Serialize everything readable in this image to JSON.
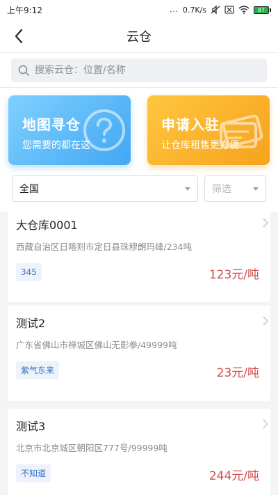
{
  "status": {
    "time": "上午9:12",
    "dots": "...",
    "speed": "0.7K/s",
    "battery": "87"
  },
  "nav": {
    "title": "云仓"
  },
  "search": {
    "placeholder": "搜索云仓：位置/名称"
  },
  "banners": [
    {
      "title": "地图寻仓",
      "subtitle": "您需要的都在这",
      "color": "#42a7f2",
      "icon": "question-bubble-icon"
    },
    {
      "title": "申请入驻",
      "subtitle": "让仓库租售更方便",
      "color": "#f7a21c",
      "icon": "card-stack-icon"
    }
  ],
  "filters": {
    "region": "全国",
    "filter_placeholder": "筛选"
  },
  "warehouses": [
    {
      "name": "大仓库0001",
      "address": "西藏自治区日喀则市定日县珠穆朗玛峰/234吨",
      "tag": "345",
      "price": "123元/吨"
    },
    {
      "name": "测试2",
      "address": "广东省佛山市禅城区佛山无影拳/49999吨",
      "tag": "紫气东来",
      "price": "23元/吨"
    },
    {
      "name": "测试3",
      "address": "北京市北京城区朝阳区777号/99999吨",
      "tag": "不知道",
      "price": "244元/吨"
    }
  ],
  "colors": {
    "price": "#d24d4d",
    "tag_text": "#3a6fc4",
    "accent_blue": "#42a7f2",
    "accent_orange": "#f7a21c"
  }
}
